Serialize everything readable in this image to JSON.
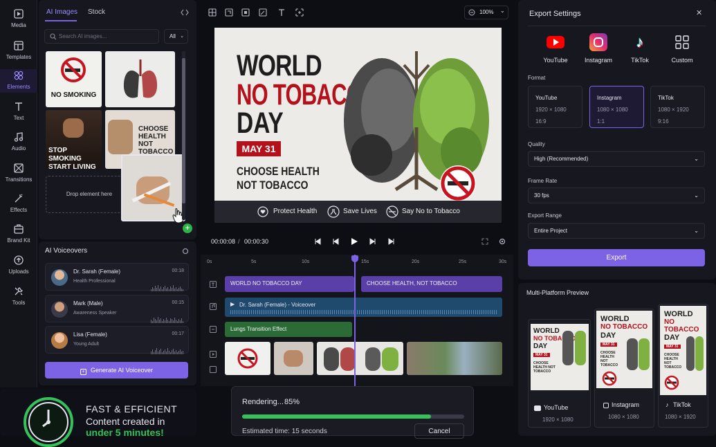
{
  "rail": [
    {
      "label": "Media",
      "icon": "media-icon"
    },
    {
      "label": "Templates",
      "icon": "templates-icon"
    },
    {
      "label": "Elements",
      "icon": "elements-icon",
      "active": true
    },
    {
      "label": "Text",
      "icon": "text-icon"
    },
    {
      "label": "Audio",
      "icon": "audio-icon"
    },
    {
      "label": "Transitions",
      "icon": "transitions-icon"
    },
    {
      "label": "Effects",
      "icon": "effects-icon"
    },
    {
      "label": "Brand Kit",
      "icon": "brand-kit-icon"
    },
    {
      "label": "Uploads",
      "icon": "uploads-icon"
    },
    {
      "label": "Tools",
      "icon": "tools-icon"
    }
  ],
  "assets": {
    "tabs": [
      "AI Images",
      "Stock"
    ],
    "search_placeholder": "Search AI images...",
    "filter": "All",
    "drop_text": "Drop element here",
    "thumb1": "NO SMOKING",
    "thumb3": "STOP SMOKING START LIVING",
    "thumb4": "CHOOSE HEALTH NOT TOBACCO"
  },
  "voice": {
    "title": "AI Voiceovers",
    "items": [
      {
        "name": "Dr. Sarah (Female)",
        "role": "Health Professional",
        "time": "00:18"
      },
      {
        "name": "Mark (Male)",
        "role": "Awareness Speaker",
        "time": "00:15"
      },
      {
        "name": "Lisa (Female)",
        "role": "Young Adult",
        "time": "00:17"
      }
    ],
    "generate": "Generate AI Voiceover"
  },
  "toolbar": {
    "zoom": "100%"
  },
  "preview": {
    "line1": "WORLD",
    "line2": "NO TOBACCO",
    "line3": "DAY",
    "date": "MAY 31",
    "tag1": "CHOOSE HEALTH",
    "tag2": "NOT TOBACCO",
    "bar": [
      "Protect Health",
      "Save Lives",
      "Say No to Tobacco"
    ]
  },
  "transport": {
    "current": "00:00:08",
    "sep": "/",
    "total": "00:00:30"
  },
  "timeline": {
    "ticks": [
      "0s",
      "5s",
      "10s",
      "15s",
      "20s",
      "25s",
      "30s"
    ],
    "text1": "WORLD NO TOBACCO DAY",
    "text2": "CHOOSE HEALTH, NOT TOBACCO",
    "voice": "Dr. Sarah (Female) - Voiceover",
    "effect": "Lungs Transition Effect",
    "playhead_seconds": 15
  },
  "export": {
    "title": "Export Settings",
    "platforms": [
      "YouTube",
      "Instagram",
      "TikTok",
      "Custom"
    ],
    "format_label": "Format",
    "formats": [
      {
        "name": "YouTube",
        "size": "1920 × 1080",
        "ratio": "16:9"
      },
      {
        "name": "Instagram",
        "size": "1080 × 1080",
        "ratio": "1:1",
        "selected": true
      },
      {
        "name": "TikTok",
        "size": "1080 × 1920",
        "ratio": "9:16"
      }
    ],
    "quality_label": "Quality",
    "quality": "High (Recommended)",
    "fps_label": "Frame Rate",
    "fps": "30 fps",
    "range_label": "Export Range",
    "range": "Entire Project",
    "button": "Export",
    "colors": {
      "accent": "#7c63e6",
      "youtube": "#ff0000"
    }
  },
  "multi": {
    "title": "Multi-Platform Preview",
    "cards": [
      {
        "platform": "YouTube",
        "size": "1920 × 1080"
      },
      {
        "platform": "Instagram",
        "size": "1080 × 1080"
      },
      {
        "platform": "TikTok",
        "size": "1080 × 1920"
      }
    ],
    "mini1": "WORLD",
    "mini2": "NO TOBACCO",
    "mini3": "DAY",
    "mini_date": "MAY 31",
    "mini_tag": "CHOOSE HEALTH NOT TOBACCO"
  },
  "promo": {
    "line1": "FAST & EFFICIENT",
    "line2": "Content created in",
    "line3": "under 5 minutes!"
  },
  "render": {
    "label": "Rendering...",
    "percent": "85%",
    "progress": 0.85,
    "eta": "Estimated time: 15 seconds",
    "cancel": "Cancel"
  }
}
